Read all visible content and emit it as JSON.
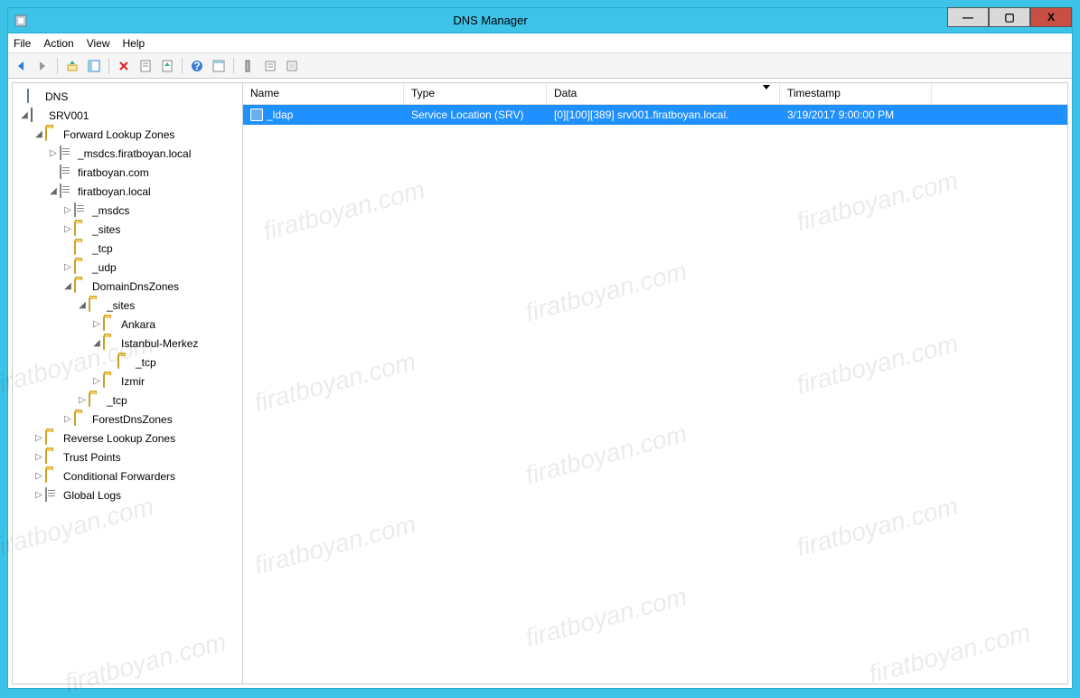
{
  "window": {
    "title": "DNS Manager"
  },
  "menu": {
    "file": "File",
    "action": "Action",
    "view": "View",
    "help": "Help"
  },
  "tree": {
    "root": "DNS",
    "server": "SRV001",
    "flz": "Forward Lookup Zones",
    "z1": "_msdcs.firatboyan.local",
    "z2": "firatboyan.com",
    "z3": "firatboyan.local",
    "msdcs": "_msdcs",
    "sites": "_sites",
    "tcp": "_tcp",
    "udp": "_udp",
    "ddz": "DomainDnsZones",
    "sites2": "_sites",
    "ankara": "Ankara",
    "istanbul": "Istanbul-Merkez",
    "tcp2": "_tcp",
    "izmir": "Izmir",
    "tcp3": "_tcp",
    "fdz": "ForestDnsZones",
    "rlz": "Reverse Lookup Zones",
    "tp": "Trust Points",
    "cf": "Conditional Forwarders",
    "gl": "Global Logs"
  },
  "columns": {
    "name": "Name",
    "type": "Type",
    "data": "Data",
    "ts": "Timestamp"
  },
  "records": [
    {
      "name": "_ldap",
      "type": "Service Location (SRV)",
      "data": "[0][100][389] srv001.firatboyan.local.",
      "ts": "3/19/2017 9:00:00 PM"
    }
  ],
  "watermark": "firatboyan.com"
}
